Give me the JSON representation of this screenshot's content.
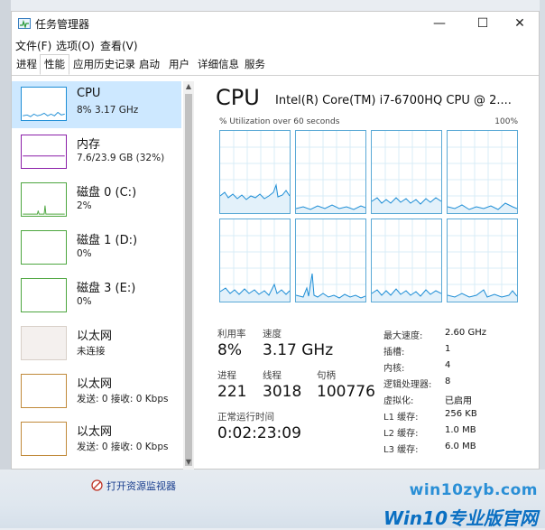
{
  "window": {
    "title": "任务管理器",
    "minimize": "—",
    "maximize": "☐",
    "close": "✕"
  },
  "menu": [
    "文件(F)",
    "选项(O)",
    "查看(V)"
  ],
  "tabs": [
    "进程",
    "性能",
    "应用历史记录",
    "启动",
    "用户",
    "详细信息",
    "服务"
  ],
  "active_tab": "性能",
  "sidebar": {
    "items": [
      {
        "name": "CPU",
        "sub": "8% 3.17 GHz",
        "color": "#1e8ed6"
      },
      {
        "name": "内存",
        "sub": "7.6/23.9 GB (32%)",
        "color": "#8b1fa8"
      },
      {
        "name": "磁盘 0 (C:)",
        "sub": "2%",
        "color": "#4da63f"
      },
      {
        "name": "磁盘 1 (D:)",
        "sub": "0%",
        "color": "#4da63f"
      },
      {
        "name": "磁盘 3 (E:)",
        "sub": "0%",
        "color": "#4da63f"
      },
      {
        "name": "以太网",
        "sub": "未连接",
        "color": "#b08a4a"
      },
      {
        "name": "以太网",
        "sub": "发送: 0 接收: 0 Kbps",
        "color": "#c08a3a"
      },
      {
        "name": "以太网",
        "sub": "发送: 0 接收: 0 Kbps",
        "color": "#c08a3a"
      }
    ]
  },
  "main": {
    "title": "CPU",
    "model": "Intel(R) Core(TM) i7-6700HQ CPU @ 2....",
    "util_label": "% Utilization over 60 seconds",
    "util_max": "100%",
    "stats": {
      "util_label": "利用率",
      "util_value": "8%",
      "speed_label": "速度",
      "speed_value": "3.17 GHz",
      "proc_label": "进程",
      "proc_value": "221",
      "thread_label": "线程",
      "thread_value": "3018",
      "handle_label": "句柄",
      "handle_value": "100776",
      "uptime_label": "正常运行时间",
      "uptime_value": "0:02:23:09"
    },
    "specs": [
      {
        "label": "最大速度:",
        "value": "2.60 GHz"
      },
      {
        "label": "插槽:",
        "value": "1"
      },
      {
        "label": "内核:",
        "value": "4"
      },
      {
        "label": "逻辑处理器:",
        "value": "8"
      },
      {
        "label": "虚拟化:",
        "value": "已启用"
      },
      {
        "label": "L1 缓存:",
        "value": "256 KB"
      },
      {
        "label": "L2 缓存:",
        "value": "1.0 MB"
      },
      {
        "label": "L3 缓存:",
        "value": "6.0 MB"
      }
    ]
  },
  "footer": {
    "link": "打开资源监视器"
  },
  "watermark": {
    "line1": "win10zyb.com",
    "line2": "Win10专业版官网"
  }
}
